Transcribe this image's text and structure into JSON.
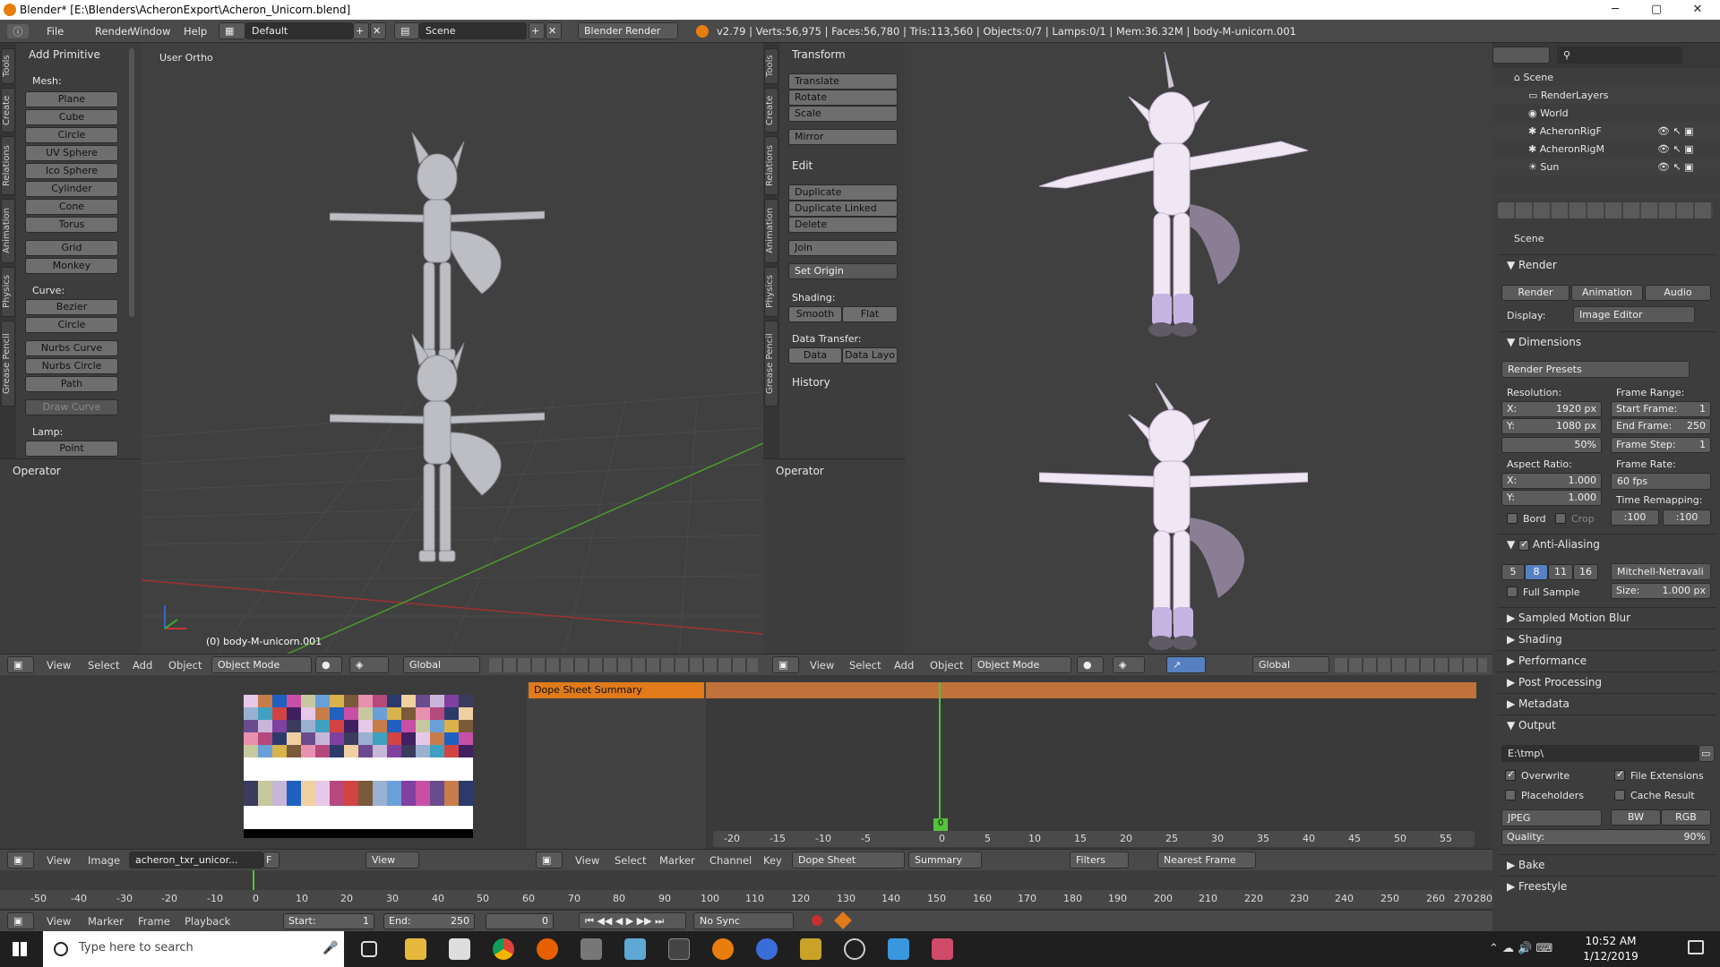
{
  "window": {
    "title": "Blender* [E:\\Blenders\\AcheronExport\\Acheron_Unicorn.blend]",
    "min": "─",
    "max": "▢",
    "close": "✕"
  },
  "infobar": {
    "menus": [
      "File",
      "Render",
      "Window",
      "Help"
    ],
    "layout": "Default",
    "scene": "Scene",
    "engine": "Blender Render",
    "stats": "v2.79 | Verts:56,975 | Faces:56,780 | Tris:113,560 | Objects:0/7 | Lamps:0/1 | Mem:36.32M | body-M-unicorn.001"
  },
  "left_vtabs": [
    "Tools",
    "Create",
    "Relations",
    "Animation",
    "Physics",
    "Grease Pencil"
  ],
  "right_vtabs": [
    "Tools",
    "Create",
    "Relations",
    "Animation",
    "Physics",
    "Grease Pencil"
  ],
  "add_primitive": {
    "header": "Add Primitive",
    "mesh_label": "Mesh:",
    "mesh": [
      "Plane",
      "Cube",
      "Circle",
      "UV Sphere",
      "Ico Sphere",
      "Cylinder",
      "Cone",
      "Torus",
      "Grid",
      "Monkey"
    ],
    "curve_label": "Curve:",
    "curve": [
      "Bezier",
      "Circle",
      "Nurbs Curve",
      "Nurbs Circle",
      "Path"
    ],
    "draw_curve": "Draw Curve",
    "lamp_label": "Lamp:",
    "lamp": [
      "Point"
    ]
  },
  "left_viewport": {
    "label": "User Ortho",
    "object": "(0) body-M-unicorn.001",
    "operator": "Operator"
  },
  "transform_panel": {
    "header": "Transform",
    "buttons": [
      "Translate",
      "Rotate",
      "Scale"
    ],
    "mirror": "Mirror",
    "edit_header": "Edit",
    "edit": [
      "Duplicate",
      "Duplicate Linked",
      "Delete"
    ],
    "join": "Join",
    "set_origin": "Set Origin",
    "shading_label": "Shading:",
    "smooth": "Smooth",
    "flat": "Flat",
    "data_transfer_label": "Data Transfer:",
    "data": "Data",
    "data_layo": "Data Layo",
    "history": "History",
    "operator": "Operator"
  },
  "viewport_header": {
    "menus": [
      "View",
      "Select",
      "Add",
      "Object"
    ],
    "mode": "Object Mode",
    "orientation": "Global"
  },
  "outliner": {
    "items": [
      "Scene",
      "RenderLayers",
      "World",
      "AcheronRigF",
      "AcheronRigM",
      "Sun"
    ]
  },
  "properties": {
    "context": "Scene",
    "render_header": "Render",
    "render_btn": "Render",
    "animation_btn": "Animation",
    "audio_btn": "Audio",
    "display_label": "Display:",
    "display_value": "Image Editor",
    "dimensions": "Dimensions",
    "render_presets": "Render Presets",
    "resolution_label": "Resolution:",
    "res_x": "X:",
    "res_x_val": "1920 px",
    "res_y": "Y:",
    "res_y_val": "1080 px",
    "res_pct": "50%",
    "frame_range_label": "Frame Range:",
    "start_frame": "Start Frame:",
    "start_frame_val": "1",
    "end_frame": "End Frame:",
    "end_frame_val": "250",
    "frame_step": "Frame Step:",
    "frame_step_val": "1",
    "aspect_label": "Aspect Ratio:",
    "asp_x": "X:",
    "asp_x_val": "1.000",
    "asp_y": "Y:",
    "asp_y_val": "1.000",
    "frame_rate_label": "Frame Rate:",
    "frame_rate_val": "60 fps",
    "time_remap_label": "Time Remapping:",
    "remap_old": ":100",
    "remap_new": ":100",
    "bord": "Bord",
    "crop": "Crop",
    "anti_aliasing": "Anti-Aliasing",
    "aa_samples": [
      "5",
      "8",
      "11",
      "16"
    ],
    "aa_filter": "Mitchell-Netravali",
    "full_sample": "Full Sample",
    "size_label": "Size:",
    "size_val": "1.000 px",
    "sampled_motion_blur": "Sampled Motion Blur",
    "shading": "Shading",
    "performance": "Performance",
    "post_processing": "Post Processing",
    "metadata": "Metadata",
    "output": "Output",
    "output_path": "E:\\tmp\\",
    "overwrite": "Overwrite",
    "file_extensions": "File Extensions",
    "placeholders": "Placeholders",
    "cache_result": "Cache Result",
    "format": "JPEG",
    "bw": "BW",
    "rgb": "RGB",
    "quality_label": "Quality:",
    "quality_val": "90%",
    "bake": "Bake",
    "freestyle": "Freestyle"
  },
  "image_editor": {
    "menus": [
      "View",
      "Image"
    ],
    "image_name": "acheron_txr_unicor...",
    "f": "F",
    "view_menu": "View"
  },
  "dopesheet": {
    "summary": "Dope Sheet Summary",
    "ticks": [
      "-20",
      "-15",
      "-10",
      "-5",
      "0",
      "5",
      "10",
      "15",
      "20",
      "25",
      "30",
      "35",
      "40",
      "45",
      "50",
      "55"
    ],
    "current_frame": "0",
    "menus": [
      "View",
      "Select",
      "Marker",
      "Channel",
      "Key"
    ],
    "mode": "Dope Sheet",
    "summary_btn": "Summary",
    "filters": "Filters",
    "nearest": "Nearest Frame"
  },
  "timeline": {
    "ticks": [
      "-50",
      "-40",
      "-30",
      "-20",
      "-10",
      "0",
      "10",
      "20",
      "30",
      "40",
      "50",
      "60",
      "70",
      "80",
      "90",
      "100",
      "110",
      "120",
      "130",
      "140",
      "150",
      "160",
      "170",
      "180",
      "190",
      "200",
      "210",
      "220",
      "230",
      "240",
      "250",
      "260",
      "270",
      "280"
    ],
    "menus": [
      "View",
      "Marker",
      "Frame",
      "Playback"
    ],
    "start": "Start:",
    "start_val": "1",
    "end": "End:",
    "end_val": "250",
    "current": "0",
    "sync": "No Sync"
  },
  "taskbar": {
    "search": "Type here to search",
    "time": "10:52 AM",
    "date": "1/12/2019"
  },
  "colors": {
    "accent": "#e07a1b",
    "selected": "#5680c2",
    "green": "#55c23d",
    "red_axis": "#a03232",
    "green_axis": "#4a9a2e"
  }
}
